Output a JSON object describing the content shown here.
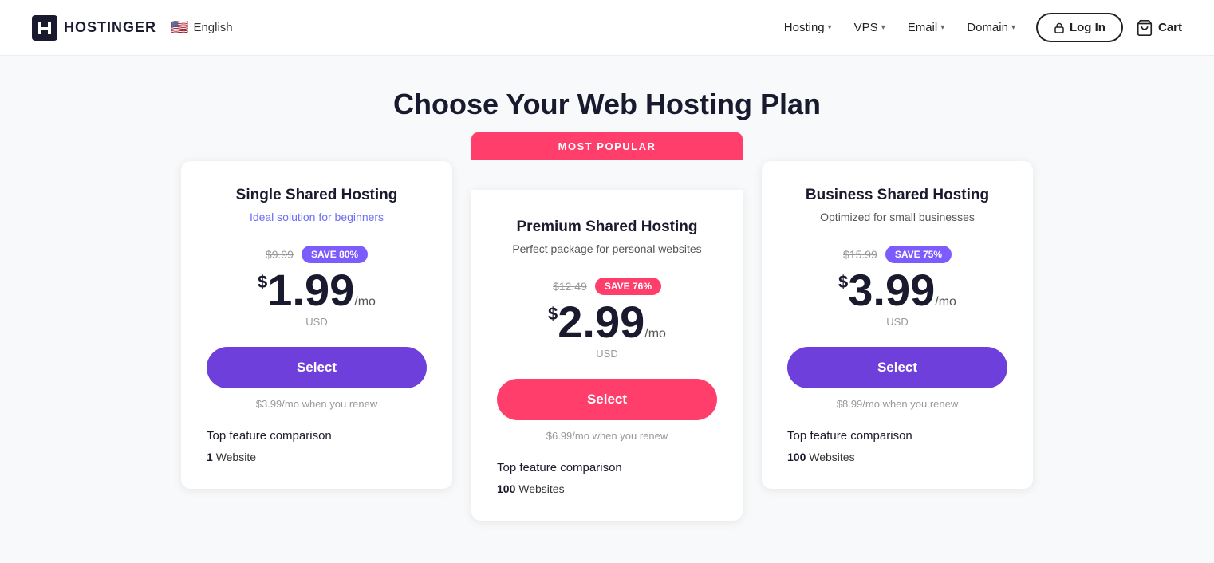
{
  "brand": {
    "name": "HOSTINGER",
    "logo_alt": "Hostinger logo"
  },
  "navbar": {
    "language": "English",
    "flag_emoji": "🇺🇸",
    "nav_items": [
      {
        "label": "Hosting",
        "has_dropdown": true
      },
      {
        "label": "VPS",
        "has_dropdown": true
      },
      {
        "label": "Email",
        "has_dropdown": true
      },
      {
        "label": "Domain",
        "has_dropdown": true
      }
    ],
    "login_label": "Log In",
    "cart_label": "Cart"
  },
  "page": {
    "title": "Choose Your Web Hosting Plan"
  },
  "plans": [
    {
      "id": "single",
      "name": "Single Shared Hosting",
      "subtitle": "Ideal solution for beginners",
      "is_popular": false,
      "original_price": "$9.99",
      "save_label": "SAVE 80%",
      "save_color": "purple",
      "price_dollar": "$",
      "price_amount": "1.99",
      "price_period": "/mo",
      "currency": "USD",
      "select_label": "Select",
      "btn_color": "purple",
      "renew_text": "$3.99/mo when you renew",
      "features_title": "Top feature comparison",
      "websites": "1",
      "websites_label": "Website"
    },
    {
      "id": "premium",
      "name": "Premium Shared Hosting",
      "subtitle": "Perfect package for personal websites",
      "is_popular": true,
      "popular_label": "MOST POPULAR",
      "original_price": "$12.49",
      "save_label": "SAVE 76%",
      "save_color": "pink",
      "price_dollar": "$",
      "price_amount": "2.99",
      "price_period": "/mo",
      "currency": "USD",
      "select_label": "Select",
      "btn_color": "pink",
      "renew_text": "$6.99/mo when you renew",
      "features_title": "Top feature comparison",
      "websites": "100",
      "websites_label": "Websites"
    },
    {
      "id": "business",
      "name": "Business Shared Hosting",
      "subtitle": "Optimized for small businesses",
      "is_popular": false,
      "original_price": "$15.99",
      "save_label": "SAVE 75%",
      "save_color": "purple",
      "price_dollar": "$",
      "price_amount": "3.99",
      "price_period": "/mo",
      "currency": "USD",
      "select_label": "Select",
      "btn_color": "purple",
      "renew_text": "$8.99/mo when you renew",
      "features_title": "Top feature comparison",
      "websites": "100",
      "websites_label": "Websites"
    }
  ]
}
